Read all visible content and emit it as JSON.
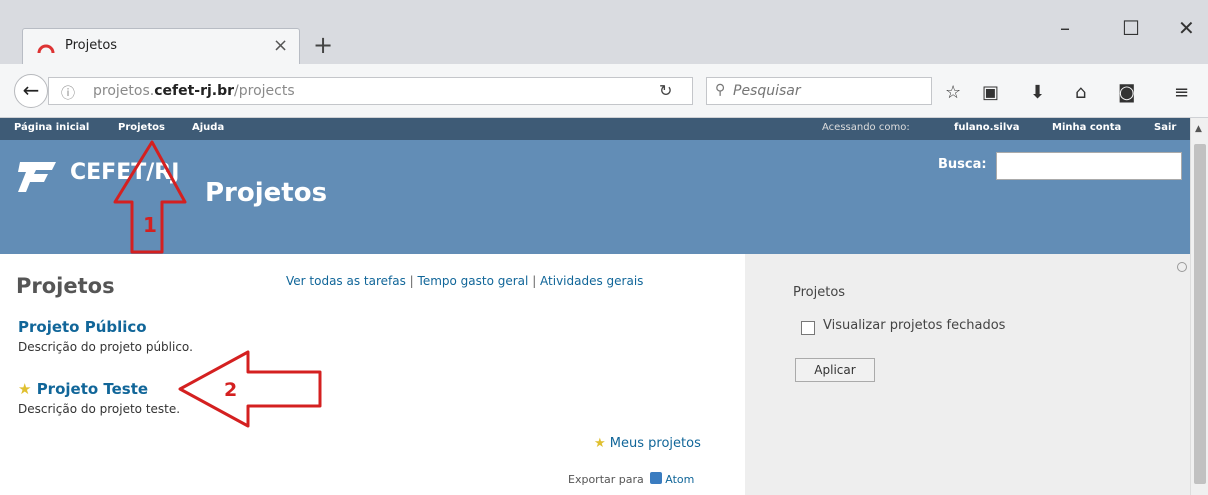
{
  "browser": {
    "tab_title": "Projetos",
    "tab_close": "×",
    "new_tab": "+",
    "url_plain": "projetos.",
    "url_bold": "cefet-rj.br",
    "url_path": "/projects",
    "search_placeholder": "Pesquisar",
    "minimize": "–",
    "maximize": "☐",
    "close": "✕"
  },
  "topmenu": {
    "home": "Página inicial",
    "projects": "Projetos",
    "help": "Ajuda",
    "logged_as_label": "Acessando como:",
    "user": "fulano.silva",
    "my_account": "Minha conta",
    "sign_out": "Sair"
  },
  "header": {
    "logo_text": "CEFET/RJ",
    "title": "Projetos",
    "search_label": "Busca:"
  },
  "main": {
    "heading": "Projetos",
    "links": [
      "Ver todas as tarefas",
      "Tempo gasto geral",
      "Atividades gerais"
    ],
    "separator": " | ",
    "projects": [
      {
        "name": "Projeto Público",
        "description": "Descrição do projeto público.",
        "starred": false
      },
      {
        "name": "Projeto Teste",
        "description": "Descrição do projeto teste.",
        "starred": true
      }
    ],
    "my_projects": "Meus projetos",
    "export_label": "Exportar para",
    "atom": "Atom"
  },
  "sidebar": {
    "title": "Projetos",
    "closed_label": "Visualizar projetos fechados",
    "apply_label": "Aplicar"
  },
  "annotations": {
    "arrow1_label": "1",
    "arrow2_label": "2",
    "color": "#d42020"
  }
}
